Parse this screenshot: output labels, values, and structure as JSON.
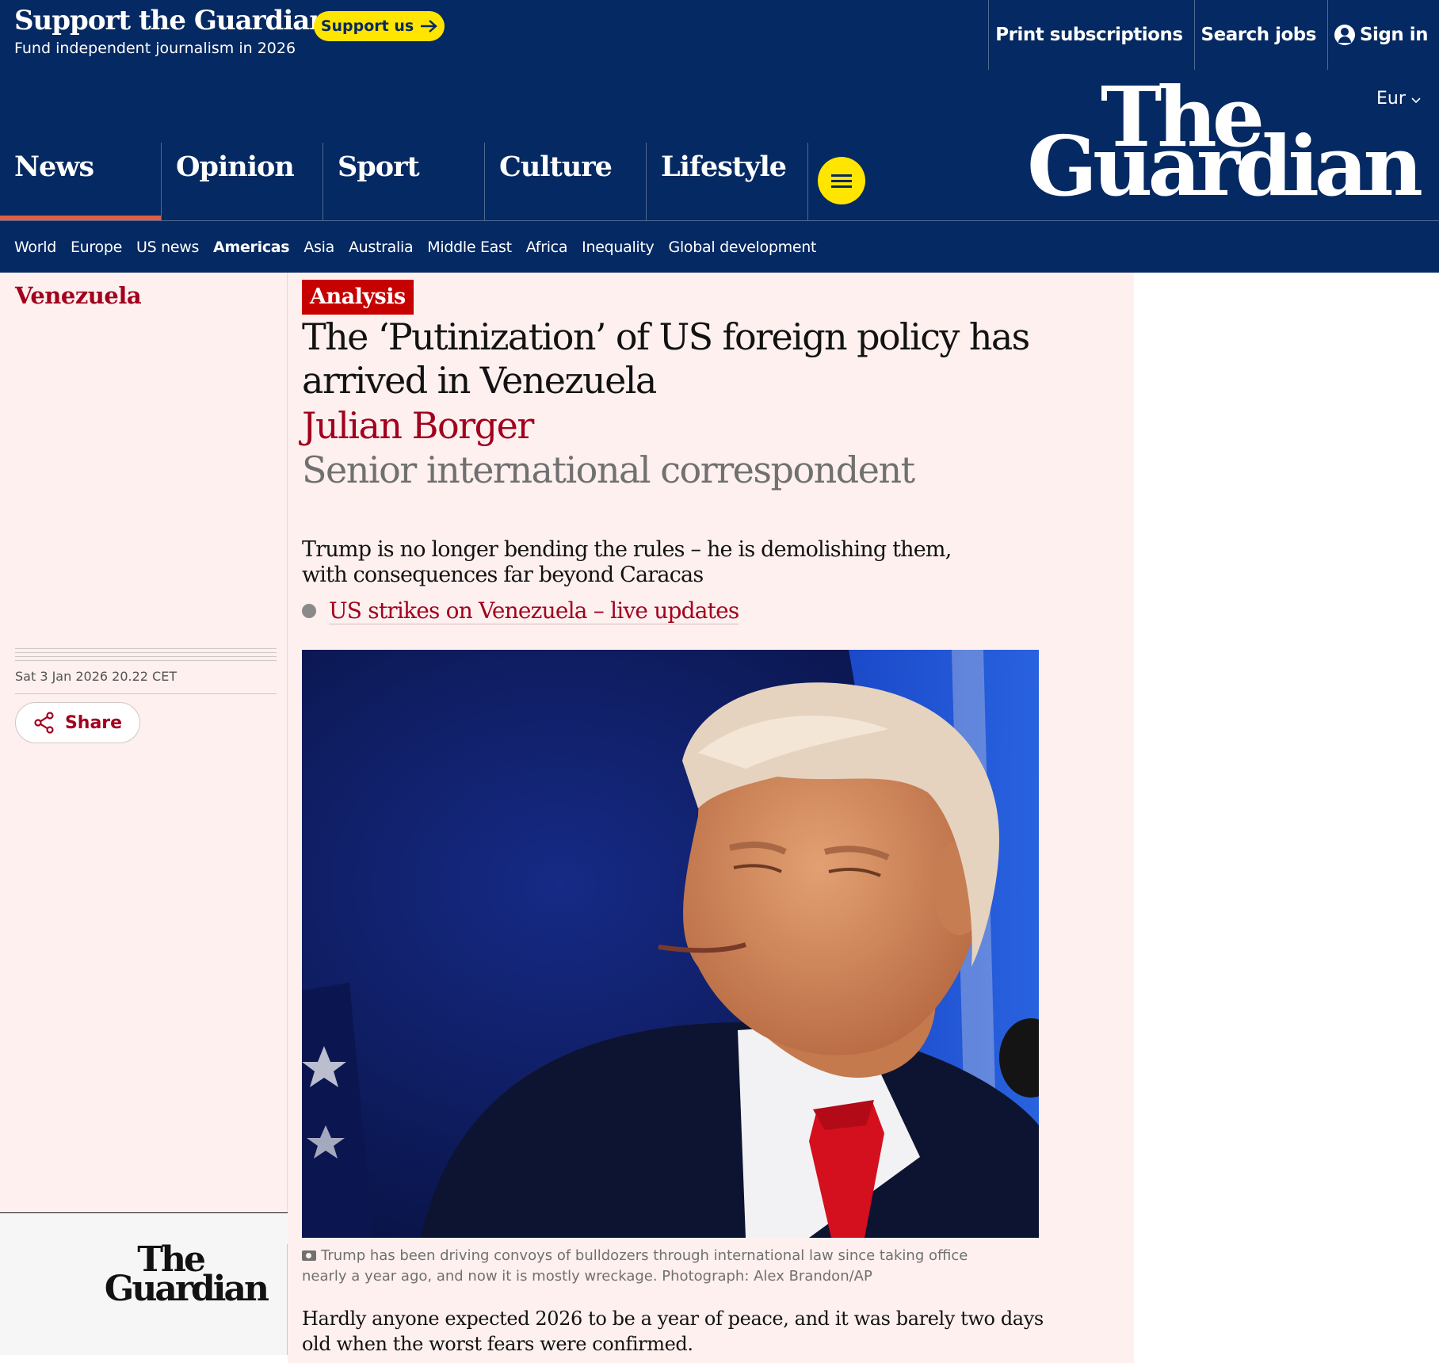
{
  "support_bar": {
    "title": "Support the Guardian",
    "subtitle": "Fund independent journalism in 2026",
    "support_button": "Support us",
    "links": {
      "print_subscriptions": "Print subscriptions",
      "search_jobs": "Search jobs",
      "sign_in": "Sign in"
    }
  },
  "header": {
    "edition": "Eur",
    "logo_line1": "The",
    "logo_line2": "Guardian",
    "pillars": [
      "News",
      "Opinion",
      "Sport",
      "Culture",
      "Lifestyle"
    ],
    "active_pillar": "News"
  },
  "subnav": {
    "items": [
      "World",
      "Europe",
      "US news",
      "Americas",
      "Asia",
      "Australia",
      "Middle East",
      "Africa",
      "Inequality",
      "Global development"
    ],
    "active": "Americas"
  },
  "left": {
    "section": "Venezuela",
    "dateline": "Sat 3 Jan 2026 20.22 CET",
    "share_label": "Share",
    "footer_logo_line1": "The",
    "footer_logo_line2": "Guardian"
  },
  "article": {
    "kicker": "Analysis",
    "headline": "The ‘Putinization’ of US foreign policy has arrived in Venezuela",
    "byline": "Julian Borger",
    "role": "Senior international correspondent",
    "standfirst": "Trump is no longer bending the rules – he is demolishing them, with consequences far beyond Caracas",
    "live_link": "US strikes on Venezuela – live updates",
    "caption": "Trump has been driving convoys of bulldozers through international law since taking office nearly a year ago, and now it is mostly wreckage. Photograph: Alex Brandon/AP",
    "body_first_paragraph": "Hardly anyone expected 2026 to be a year of peace, and it was barely two days old when the worst fears were confirmed."
  },
  "colors": {
    "brand_navy": "#052962",
    "accent_yellow": "#ffe500",
    "news_red": "#a1001e",
    "kicker_red": "#c70000",
    "pillar_underline": "#e05e47",
    "page_tint": "#fdf0ee"
  },
  "icons": {
    "support_arrow": "arrow-right-icon",
    "sign_in": "user-icon",
    "edition": "chevron-down-icon",
    "menu": "hamburger-icon",
    "share": "share-icon",
    "caption": "camera-icon",
    "live": "dot-icon"
  }
}
